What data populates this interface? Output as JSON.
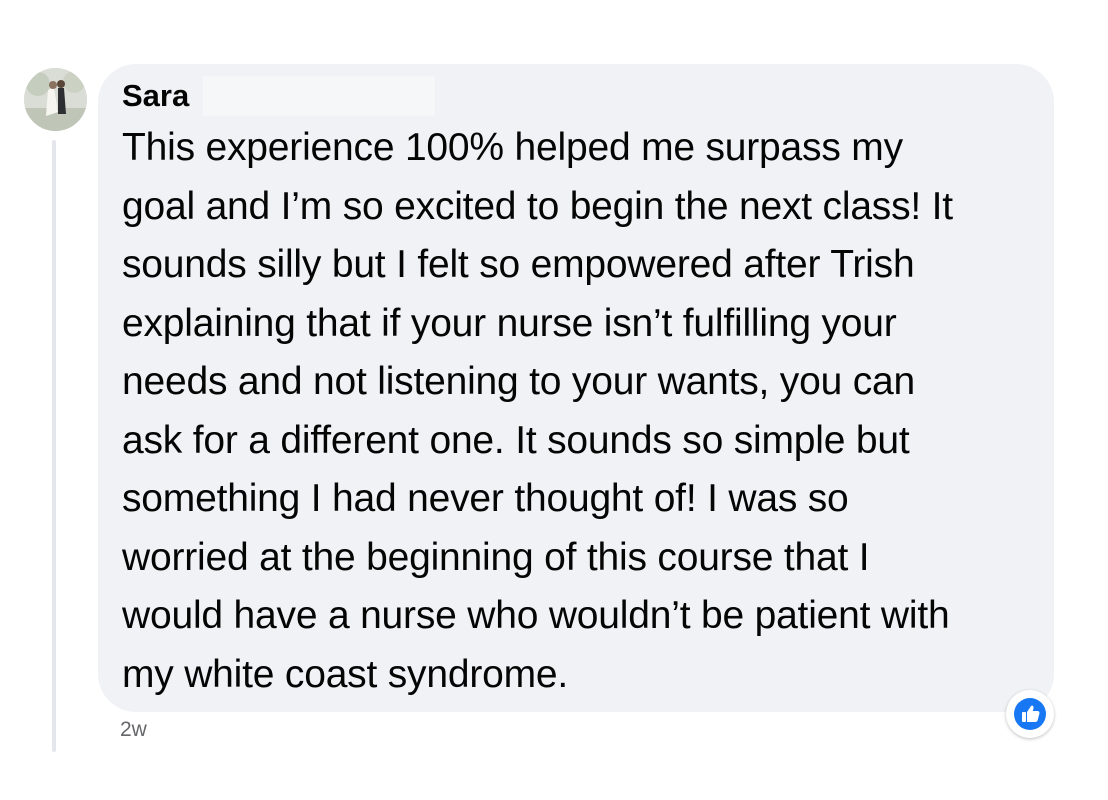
{
  "comment": {
    "author": "Sara",
    "text": "This experience 100% helped me surpass my\ngoal and I’m so excited to begin the next class! It\nsounds silly but I felt so empowered after Trish\nexplaining that if your nurse isn’t fulfilling your\nneeds and not listening to your wants, you can\nask for a different one. It sounds so simple but\nsomething I had never thought of! I was so\nworried at the beginning of this course that I\nwould have a nurse who wouldn’t be patient with\nmy white coast syndrome.",
    "timestamp": "2w",
    "reaction_icon": "like-icon",
    "colors": {
      "bubble": "#f0f2f5",
      "text": "#050505",
      "meta": "#65676b",
      "like": "#1877f2"
    }
  }
}
